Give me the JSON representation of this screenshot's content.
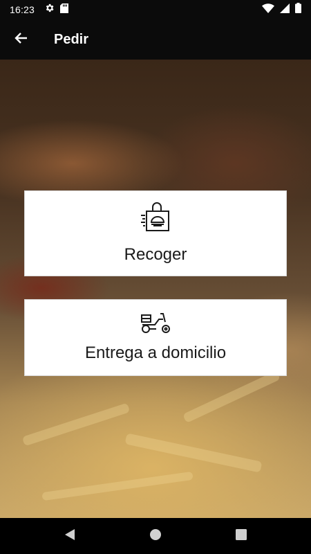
{
  "status_bar": {
    "time": "16:23",
    "left_icons": [
      "gear-icon",
      "sd-card-icon"
    ],
    "right_icons": [
      "wifi-icon",
      "cell-signal-icon",
      "battery-icon"
    ]
  },
  "app_bar": {
    "back_icon": "arrow-left-icon",
    "title": "Pedir"
  },
  "options": [
    {
      "icon": "takeaway-bag-icon",
      "label": "Recoger"
    },
    {
      "icon": "delivery-scooter-icon",
      "label": "Entrega a domicilio"
    }
  ],
  "nav_bar": {
    "buttons": [
      "back-triangle-icon",
      "home-circle-icon",
      "recents-square-icon"
    ]
  },
  "colors": {
    "bars": "#0b0b0b",
    "card_bg": "#ffffff",
    "card_text": "#1a1a1a"
  }
}
